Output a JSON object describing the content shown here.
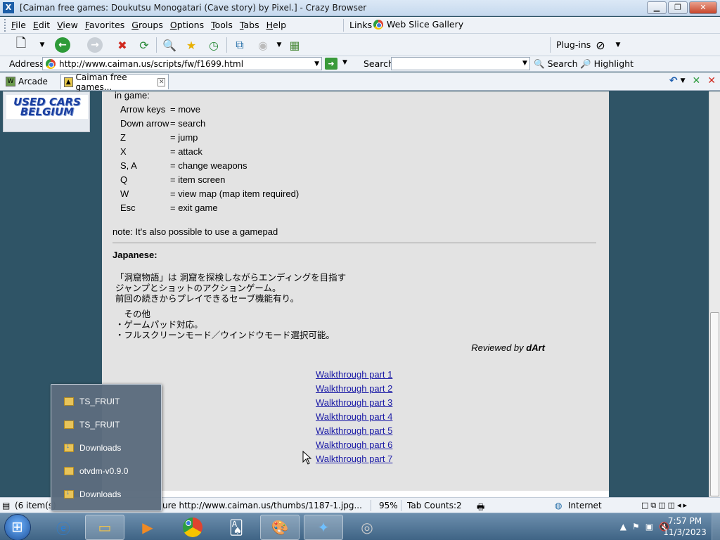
{
  "window": {
    "title": "[Caiman free games: Doukutsu Monogatari (Cave story) by Pixel.] - Crazy Browser",
    "app_icon": "X",
    "minimize": "▁",
    "maximize": "❐",
    "close": "✕"
  },
  "menu": {
    "items": [
      "File",
      "Edit",
      "View",
      "Favorites",
      "Groups",
      "Options",
      "Tools",
      "Tabs",
      "Help"
    ],
    "links_label": "Links",
    "webslice_label": "Web Slice Gallery"
  },
  "toolbar": {
    "plugins_label": "Plug-ins"
  },
  "address": {
    "label": "Address",
    "url": "http://www.caiman.us/scripts/fw/f1699.html",
    "search_label": "Search",
    "search_value": "",
    "search_button": "Search",
    "highlight_button": "Highlight"
  },
  "tabs": [
    {
      "label": "Arcade",
      "active": false
    },
    {
      "label": "Caiman free games...",
      "active": true
    }
  ],
  "sidebar_ad": {
    "text_line1": "USED CARS",
    "text_line2": "BELGIUM"
  },
  "page": {
    "in_game_label": "in game:",
    "controls": [
      {
        "key": "Arrow keys",
        "action": "= move"
      },
      {
        "key": "Down arrow",
        "action": "= search"
      },
      {
        "key": "Z",
        "action": "= jump"
      },
      {
        "key": "X",
        "action": "= attack"
      },
      {
        "key": "S, A",
        "action": "= change weapons"
      },
      {
        "key": "Q",
        "action": "= item screen"
      },
      {
        "key": "W",
        "action": "= view map (map item required)"
      },
      {
        "key": "Esc",
        "action": "= exit game"
      }
    ],
    "note": "note: It's also possible to use a gamepad",
    "japanese_heading": "Japanese:",
    "jp_lines_1": [
      "「洞窟物語」は 洞窟を探検しながらエンディングを目指す",
      "ジャンプとショットのアクションゲーム。",
      "前回の続きからプレイできるセーブ機能有り。"
    ],
    "jp_lines_2": [
      "　その他",
      "・ゲームパッド対応。",
      "・フルスクリーンモード／ウインドウモード選択可能。"
    ],
    "reviewed_by_prefix": "Reviewed by ",
    "reviewer": "dArt",
    "walkthroughs": [
      "Walkthrough part 1",
      "Walkthrough part 2",
      "Walkthrough part 3",
      "Walkthrough part 4",
      "Walkthrough part 5",
      "Walkthrough part 6",
      "Walkthrough part 7"
    ]
  },
  "jumplist": {
    "items": [
      {
        "label": "TS_FRUIT",
        "icon": "folder-icon"
      },
      {
        "label": "TS_FRUIT",
        "icon": "folder-icon"
      },
      {
        "label": "Downloads",
        "icon": "downloads-folder-icon"
      },
      {
        "label": "otvdm-v0.9.0",
        "icon": "folder-icon"
      },
      {
        "label": "Downloads",
        "icon": "downloads-folder-icon"
      }
    ]
  },
  "status": {
    "items_count": "(6 item(s)",
    "loading_text": "ure http://www.caiman.us/thumbs/1187-1.jpg...",
    "zoom": "95%",
    "tab_counts": "Tab Counts:2",
    "zone": "Internet"
  },
  "taskbar": {
    "time": "7:57 PM",
    "date": "11/3/2023"
  }
}
